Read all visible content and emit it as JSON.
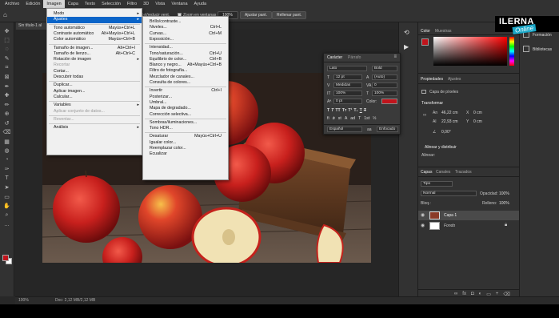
{
  "menubar": [
    "Archivo",
    "Edición",
    "Imagen",
    "Capa",
    "Texto",
    "Selección",
    "Filtro",
    "3D",
    "Vista",
    "Ventana",
    "Ayuda"
  ],
  "menubar_active_index": 2,
  "options_bar": {
    "partial_text": "Sel/reducir vent.",
    "zoom_all": "Zoom en ventanas",
    "zoom_value": "100%",
    "fit_button": "Ajustar pant.",
    "fill_button": "Rellenar pant."
  },
  "doc_tab": "Sin título-1 al",
  "image_menu": {
    "items": [
      {
        "label": "Modo",
        "shortcut": "",
        "submenu": true,
        "disabled": false
      },
      {
        "label": "Ajustes",
        "shortcut": "",
        "submenu": true,
        "disabled": false,
        "highlighted": true
      },
      {
        "sep": true
      },
      {
        "label": "Tono automático",
        "shortcut": "Mayús+Ctrl+L"
      },
      {
        "label": "Contraste automático",
        "shortcut": "Alt+Mayús+Ctrl+L"
      },
      {
        "label": "Color automático",
        "shortcut": "Mayús+Ctrl+B"
      },
      {
        "sep": true
      },
      {
        "label": "Tamaño de imagen...",
        "shortcut": "Alt+Ctrl+I"
      },
      {
        "label": "Tamaño de lienzo...",
        "shortcut": "Alt+Ctrl+C"
      },
      {
        "label": "Rotación de imagen",
        "shortcut": "",
        "submenu": true
      },
      {
        "label": "Recortar",
        "shortcut": "",
        "disabled": true
      },
      {
        "label": "Cortar...",
        "shortcut": ""
      },
      {
        "label": "Descubrir todas",
        "shortcut": ""
      },
      {
        "sep": true
      },
      {
        "label": "Duplicar...",
        "shortcut": ""
      },
      {
        "label": "Aplicar imagen...",
        "shortcut": ""
      },
      {
        "label": "Calcular...",
        "shortcut": ""
      },
      {
        "sep": true
      },
      {
        "label": "Variables",
        "shortcut": "",
        "submenu": true
      },
      {
        "label": "Aplicar conjunto de datos...",
        "shortcut": "",
        "disabled": true
      },
      {
        "sep": true
      },
      {
        "label": "Reventar...",
        "shortcut": "",
        "disabled": true
      },
      {
        "sep": true
      },
      {
        "label": "Análisis",
        "shortcut": "",
        "submenu": true
      }
    ]
  },
  "adjust_menu": {
    "items": [
      {
        "label": "Brillo/contraste...",
        "shortcut": ""
      },
      {
        "label": "Niveles...",
        "shortcut": "Ctrl+L"
      },
      {
        "label": "Curvas...",
        "shortcut": "Ctrl+M"
      },
      {
        "label": "Exposición...",
        "shortcut": ""
      },
      {
        "sep": true
      },
      {
        "label": "Intensidad...",
        "shortcut": ""
      },
      {
        "label": "Tono/saturación...",
        "shortcut": "Ctrl+U"
      },
      {
        "label": "Equilibrio de color...",
        "shortcut": "Ctrl+B"
      },
      {
        "label": "Blanco y negro...",
        "shortcut": "Alt+Mayús+Ctrl+B"
      },
      {
        "label": "Filtro de fotografía...",
        "shortcut": ""
      },
      {
        "label": "Mezclador de canales...",
        "shortcut": ""
      },
      {
        "label": "Consulta de colores...",
        "shortcut": ""
      },
      {
        "sep": true
      },
      {
        "label": "Invertir",
        "shortcut": "Ctrl+I"
      },
      {
        "label": "Posterizar...",
        "shortcut": ""
      },
      {
        "label": "Umbral...",
        "shortcut": ""
      },
      {
        "label": "Mapa de degradado...",
        "shortcut": ""
      },
      {
        "label": "Corrección selectiva...",
        "shortcut": ""
      },
      {
        "sep": true
      },
      {
        "label": "Sombras/iluminaciones...",
        "shortcut": ""
      },
      {
        "label": "Tono HDR...",
        "shortcut": ""
      },
      {
        "sep": true
      },
      {
        "label": "Desaturar",
        "shortcut": "Mayús+Ctrl+U"
      },
      {
        "label": "Igualar color...",
        "shortcut": ""
      },
      {
        "label": "Reemplazar color...",
        "shortcut": ""
      },
      {
        "label": "Ecualizar",
        "shortcut": ""
      }
    ]
  },
  "character_panel": {
    "tabs": [
      "Carácter",
      "Párrafo"
    ],
    "font": "Lato",
    "style": "Bold",
    "size": "12 pt",
    "leading": "(Auto)",
    "kerning": "Medidas",
    "tracking": "0",
    "vscale": "100%",
    "hscale": "100%",
    "baseline": "0 pt",
    "color_label": "Color:",
    "color": "#c0141c",
    "language": "Español",
    "antialias": "Enfocado"
  },
  "color_panel": {
    "tabs": [
      "Color",
      "Muestras"
    ]
  },
  "properties_panel": {
    "tabs": [
      "Propiedades",
      "Ajustes"
    ],
    "layer_type": "Capa de píxeles",
    "section": "Transformar",
    "an_label": "An",
    "w": "46,22 cm",
    "x": "0 cm",
    "al_label": "Al",
    "h": "22,93 cm",
    "y": "0 cm",
    "angle": "0,00°",
    "align_section": "Alinear y distribuir",
    "align_sub": "Alinear:"
  },
  "layers_panel": {
    "tabs": [
      "Capas",
      "Canales",
      "Trazados"
    ],
    "filter": "Tipo",
    "blend": "Normal",
    "opacity_label": "Opacidad:",
    "opacity": "100%",
    "lock_label": "Bloq.:",
    "fill_label": "Relleno:",
    "fill": "100%",
    "layers": [
      {
        "name": "Capa 1",
        "italic": false
      },
      {
        "name": "Fondo",
        "italic": true
      }
    ]
  },
  "right_icons": [
    {
      "label": "Formación"
    },
    {
      "label": "Bibliotecas"
    }
  ],
  "logo": {
    "line1": "ILERNA",
    "line2": "Online"
  },
  "statusbar": {
    "zoom": "100%",
    "doc": "Doc: 2,12 MB/2,12 MB"
  }
}
